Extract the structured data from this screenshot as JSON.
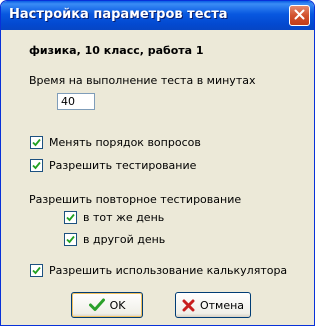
{
  "window": {
    "title": "Настройка параметров теста"
  },
  "test_name": "физика, 10 класс, работа 1",
  "time_limit": {
    "label": "Время на выполнение теста в минутах",
    "value": "40"
  },
  "options": {
    "shuffle_questions": {
      "label": "Менять порядок вопросов",
      "checked": true
    },
    "allow_testing": {
      "label": "Разрешить тестирование",
      "checked": true
    }
  },
  "retest": {
    "label": "Разрешить повторное тестирование",
    "same_day": {
      "label": "в тот же день",
      "checked": true
    },
    "other_day": {
      "label": "в другой день",
      "checked": true
    }
  },
  "calculator": {
    "label": "Разрешить использование калькулятора",
    "checked": true
  },
  "buttons": {
    "ok_label": "OK",
    "cancel_label": "Отмена"
  },
  "colors": {
    "titlebar": "#0858e0",
    "check": "#21a121",
    "ok_icon": "#2aa02a",
    "cancel_icon": "#c81e1e"
  },
  "icons": {
    "close": "close-icon",
    "check": "checkmark-icon",
    "ok": "green-check-icon",
    "cancel": "red-x-icon"
  }
}
